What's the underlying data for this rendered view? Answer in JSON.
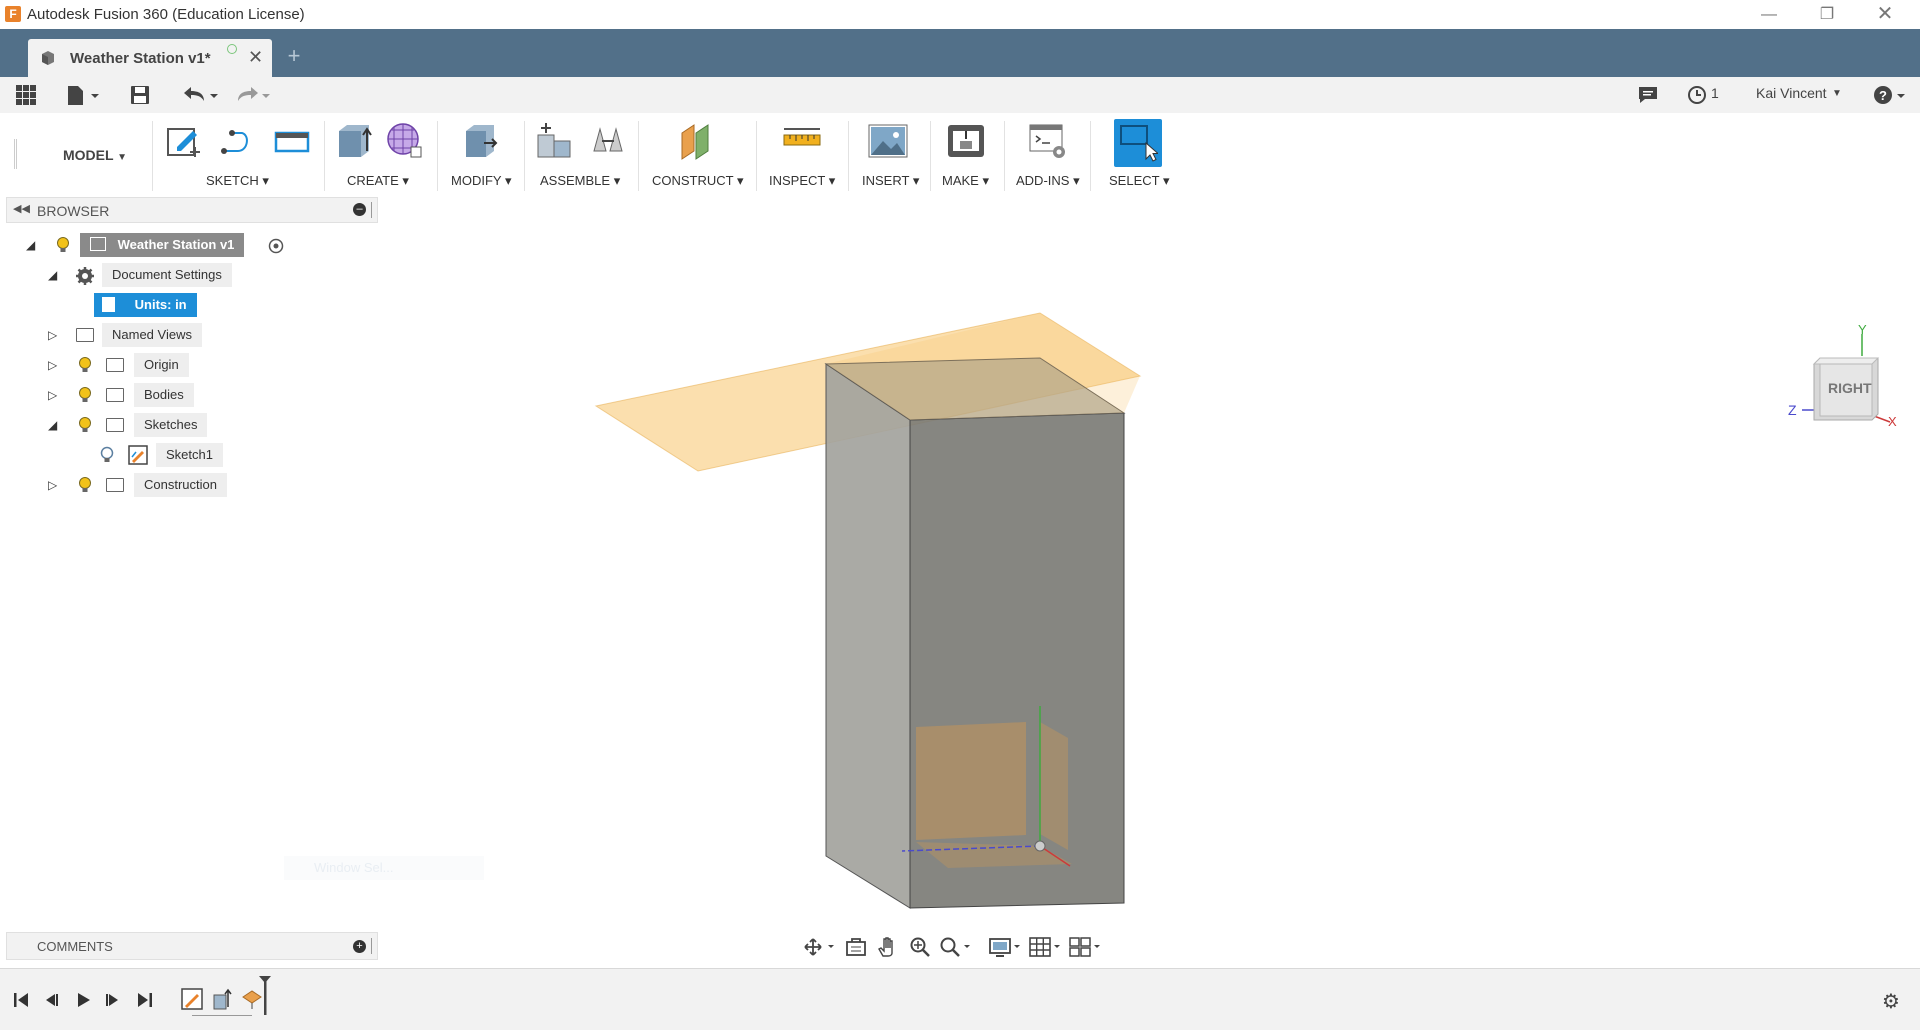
{
  "window": {
    "title": "Autodesk Fusion 360 (Education License)",
    "controls": [
      "minimize-icon",
      "restore-icon",
      "close-icon"
    ]
  },
  "tabs": [
    {
      "label": "Weather Station v1*",
      "active": true
    }
  ],
  "quick_access": {
    "notifications_count": "1",
    "user_name": "Kai Vincent"
  },
  "toolbar": {
    "workspace": "MODEL",
    "groups": [
      {
        "label": "SKETCH"
      },
      {
        "label": "CREATE"
      },
      {
        "label": "MODIFY"
      },
      {
        "label": "ASSEMBLE"
      },
      {
        "label": "CONSTRUCT"
      },
      {
        "label": "INSPECT"
      },
      {
        "label": "INSERT"
      },
      {
        "label": "MAKE"
      },
      {
        "label": "ADD-INS"
      },
      {
        "label": "SELECT"
      }
    ],
    "dropdown_arrow": "▾"
  },
  "browser": {
    "title": "BROWSER",
    "items": [
      {
        "label": "Weather Station v1"
      },
      {
        "label": "Document Settings"
      },
      {
        "label": "Units: in"
      },
      {
        "label": "Named Views"
      },
      {
        "label": "Origin"
      },
      {
        "label": "Bodies"
      },
      {
        "label": "Sketches"
      },
      {
        "label": "Sketch1"
      },
      {
        "label": "Construction"
      }
    ]
  },
  "viewcube": {
    "face": "RIGHT",
    "axes": {
      "y": "Y",
      "z": "Z",
      "x": "X"
    }
  },
  "viewport": {
    "ghost_text": "Window Sel..."
  },
  "comments": {
    "title": "COMMENTS"
  },
  "colors": {
    "tab_bar": "#527089",
    "accent_blue": "#1d8ed8",
    "plane_orange": "#f7c46c",
    "body_gray": "#7a7a74"
  }
}
